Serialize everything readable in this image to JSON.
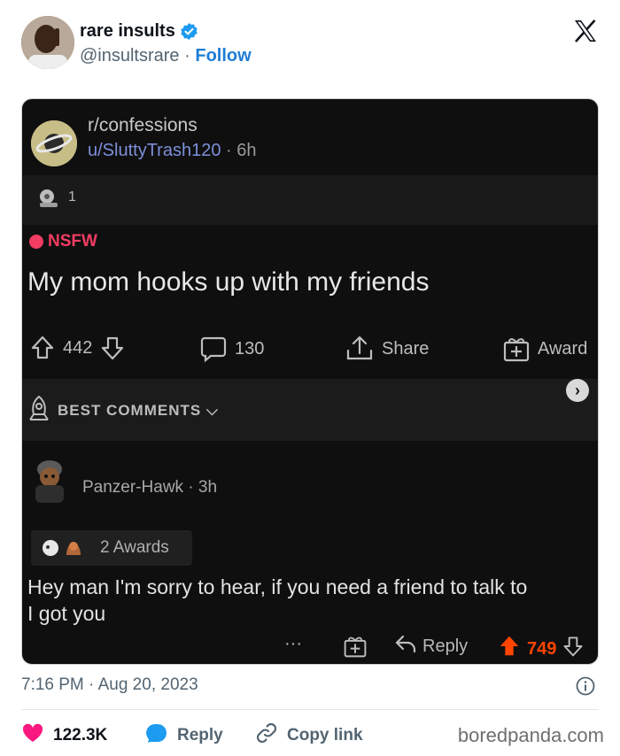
{
  "tweet": {
    "author_name": "rare insults",
    "handle": "@insultsrare",
    "separator": "·",
    "follow_label": "Follow",
    "timestamp": "7:16 PM · Aug 20, 2023",
    "likes": "122.3K",
    "reply_label": "Reply",
    "copy_link_label": "Copy link",
    "watermark": "boredpanda.com",
    "colors": {
      "verified": "#1d9bf0",
      "like": "#f91880",
      "reply": "#1d9bf0",
      "follow": "#1d7dd6"
    }
  },
  "embed": {
    "subreddit": "r/confessions",
    "username": "u/SluttyTrash120",
    "post_age": "· 6h",
    "award_count": "1",
    "nsfw_label": "NSFW",
    "title": "My mom hooks up with my friends",
    "upvotes": "442",
    "comments": "130",
    "share_label": "Share",
    "award_label": "Award",
    "sort_label": "BEST COMMENTS",
    "comment": {
      "author": "PanzerHawk",
      "author_display": "Panzer-Hawk",
      "age": "· 3h",
      "awards_label": "2 Awards",
      "body_line1": "Hey man I'm sorry to hear, if you need a friend to talk to",
      "body_line2": "I got you",
      "more_label": "···",
      "reply_label": "Reply",
      "score": "749"
    }
  }
}
